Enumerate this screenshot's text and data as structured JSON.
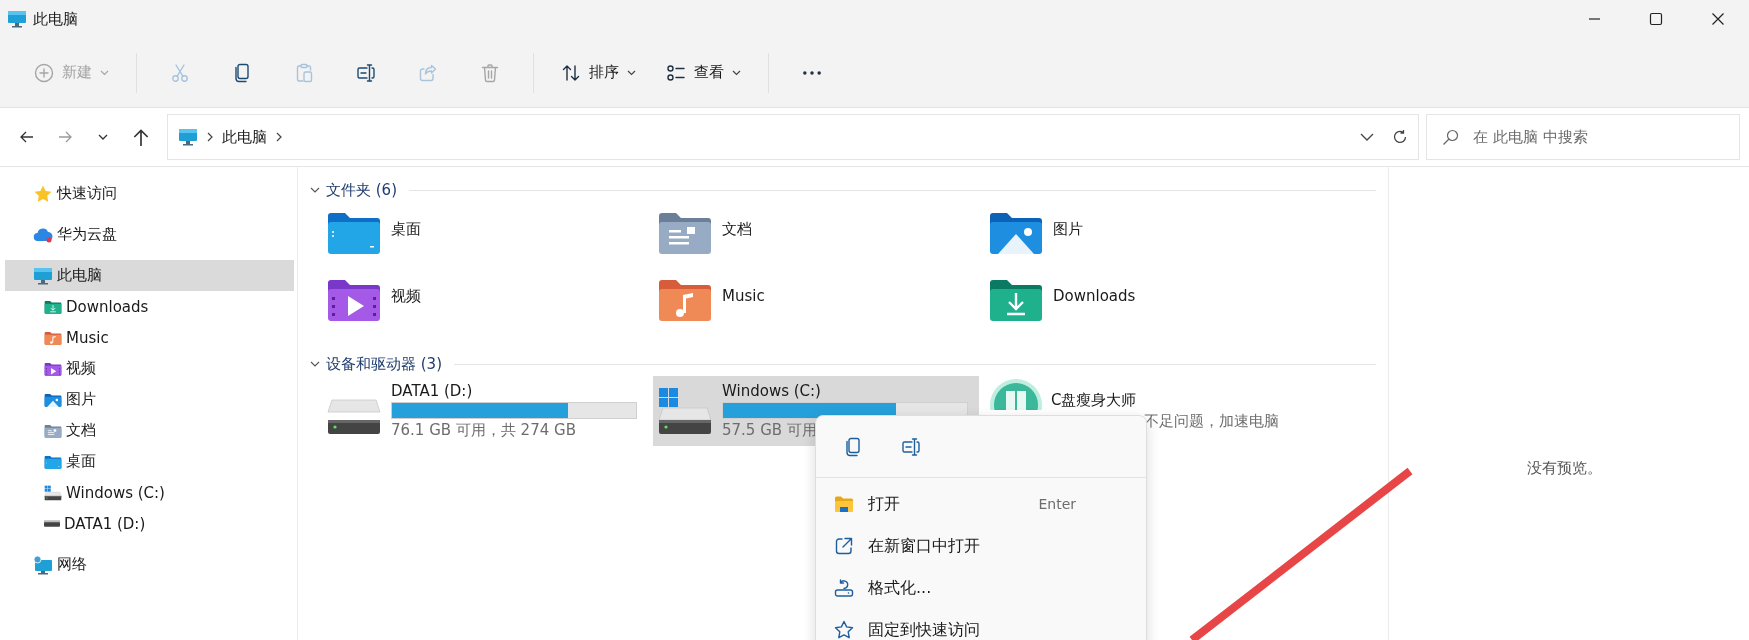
{
  "window": {
    "title": "此电脑"
  },
  "toolbar": [
    {
      "kind": "new",
      "label": "新建",
      "disabled": true
    },
    {
      "kind": "separator"
    },
    {
      "kind": "cut",
      "disabled": true
    },
    {
      "kind": "copy",
      "disabled": false
    },
    {
      "kind": "paste",
      "disabled": true
    },
    {
      "kind": "rename",
      "disabled": false
    },
    {
      "kind": "share",
      "disabled": true
    },
    {
      "kind": "delete",
      "disabled": true
    },
    {
      "kind": "separator"
    },
    {
      "kind": "sort",
      "label": "排序",
      "disabled": false
    },
    {
      "kind": "view",
      "label": "查看",
      "disabled": false
    },
    {
      "kind": "separator"
    },
    {
      "kind": "more",
      "disabled": false
    }
  ],
  "nav": [
    {
      "kind": "back",
      "disabled": false
    },
    {
      "kind": "forward",
      "disabled": true
    },
    {
      "kind": "recent",
      "disabled": false
    },
    {
      "kind": "up",
      "disabled": false
    }
  ],
  "address": {
    "path": [
      "此电脑"
    ]
  },
  "search": {
    "placeholder": "在 此电脑 中搜索"
  },
  "sidebar": {
    "items": [
      {
        "kind": "star",
        "label": "快速访问",
        "selected": false
      },
      {
        "kind": "cloud",
        "label": "华为云盘",
        "selected": false
      },
      {
        "kind": "pc",
        "label": "此电脑",
        "selected": true,
        "children": [
          {
            "kind": "downloads",
            "label": "Downloads",
            "selected": false
          },
          {
            "kind": "music",
            "label": "Music",
            "selected": false
          },
          {
            "kind": "video",
            "label": "视频",
            "selected": false
          },
          {
            "kind": "pictures",
            "label": "图片",
            "selected": false
          },
          {
            "kind": "documents",
            "label": "文档",
            "selected": false
          },
          {
            "kind": "desktop",
            "label": "桌面",
            "selected": false
          },
          {
            "kind": "system",
            "label": "Windows (C:)",
            "selected": false
          },
          {
            "kind": "drive",
            "label": "DATA1 (D:)",
            "selected": false
          }
        ]
      },
      {
        "kind": "network",
        "label": "网络",
        "selected": false
      }
    ]
  },
  "sections": [
    {
      "title": "文件夹 (6)",
      "expanded": true,
      "items": [
        {
          "kind": "desktop",
          "name": "桌面"
        },
        {
          "kind": "documents",
          "name": "文档"
        },
        {
          "kind": "pictures",
          "name": "图片"
        },
        {
          "kind": "video",
          "name": "视频"
        },
        {
          "kind": "music",
          "name": "Music"
        },
        {
          "kind": "downloads",
          "name": "Downloads"
        }
      ]
    },
    {
      "title": "设备和驱动器 (3)",
      "expanded": true,
      "items": [
        {
          "kind": "drive",
          "name": "DATA1 (D:)",
          "level": 0.72,
          "detail": "76.1 GB 可用，共 274 GB",
          "selected": false
        },
        {
          "kind": "system",
          "name": "Windows (C:)",
          "level": 0.71,
          "detail": "57.5 GB 可用",
          "selected": true
        },
        {
          "kind": "app",
          "name": "C盘瘦身大师",
          "detail": "不足问题，加速电脑",
          "selected": false
        }
      ]
    }
  ],
  "context_menu": {
    "actions": [
      {
        "kind": "copy"
      },
      {
        "kind": "rename"
      }
    ],
    "items": [
      {
        "kind": "open",
        "label": "打开",
        "shortcut": "Enter"
      },
      {
        "kind": "newwindow",
        "label": "在新窗口中打开"
      },
      {
        "kind": "format",
        "label": "格式化..."
      },
      {
        "kind": "pin",
        "label": "固定到快速访问"
      }
    ]
  },
  "preview": {
    "message": "没有预览。"
  }
}
